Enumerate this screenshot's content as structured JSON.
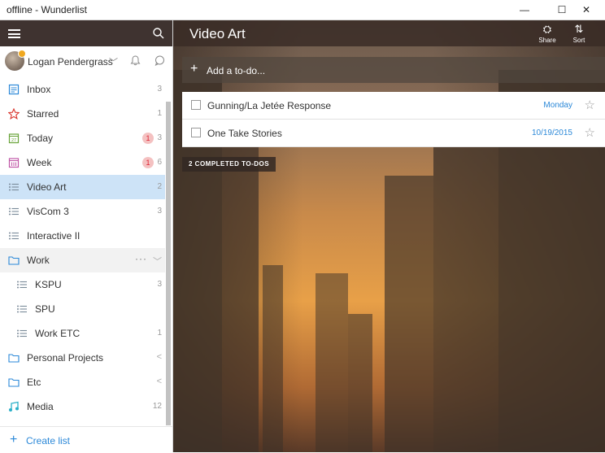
{
  "window": {
    "title": "offline - Wunderlist",
    "minimize": "—",
    "maximize": "☐",
    "close": "✕"
  },
  "user": {
    "name": "Logan Pendergrass"
  },
  "sidebar": {
    "items": [
      {
        "label": "Inbox",
        "count": "3",
        "icon": "inbox-icon",
        "color": "#2b88d8"
      },
      {
        "label": "Starred",
        "count": "1",
        "icon": "star-icon",
        "color": "#d9342b"
      },
      {
        "label": "Today",
        "count": "3",
        "badge": "1",
        "icon": "calendar-today-icon",
        "color": "#69a43a"
      },
      {
        "label": "Week",
        "count": "6",
        "badge": "1",
        "icon": "calendar-week-icon",
        "color": "#c056a6"
      },
      {
        "label": "Video Art",
        "count": "2",
        "icon": "list-icon",
        "active": true
      },
      {
        "label": "VisCom 3",
        "count": "3",
        "icon": "list-icon"
      },
      {
        "label": "Interactive II",
        "count": "",
        "icon": "list-icon"
      },
      {
        "label": "Work",
        "icon": "folder-icon",
        "group": true
      },
      {
        "label": "KSPU",
        "count": "3",
        "icon": "list-icon",
        "indent": true
      },
      {
        "label": "SPU",
        "count": "",
        "icon": "list-icon",
        "indent": true
      },
      {
        "label": "Work ETC",
        "count": "1",
        "icon": "list-icon",
        "indent": true
      },
      {
        "label": "Personal Projects",
        "icon": "folder-icon",
        "collapsed": true
      },
      {
        "label": "Etc",
        "icon": "folder-icon",
        "collapsed": true
      },
      {
        "label": "Media",
        "count": "12",
        "icon": "music-icon"
      }
    ],
    "create_label": "Create list"
  },
  "main": {
    "title": "Video Art",
    "share_label": "Share",
    "sort_label": "Sort",
    "add_placeholder": "Add a to-do...",
    "tasks": [
      {
        "title": "Gunning/La Jetée Response",
        "due": "Monday"
      },
      {
        "title": "One Take Stories",
        "due": "10/19/2015"
      }
    ],
    "completed_label": "2 COMPLETED TO-DOS"
  },
  "colors": {
    "accent": "#2b88d8",
    "header_bg": "#3f3330",
    "active_bg": "#cde3f7"
  }
}
